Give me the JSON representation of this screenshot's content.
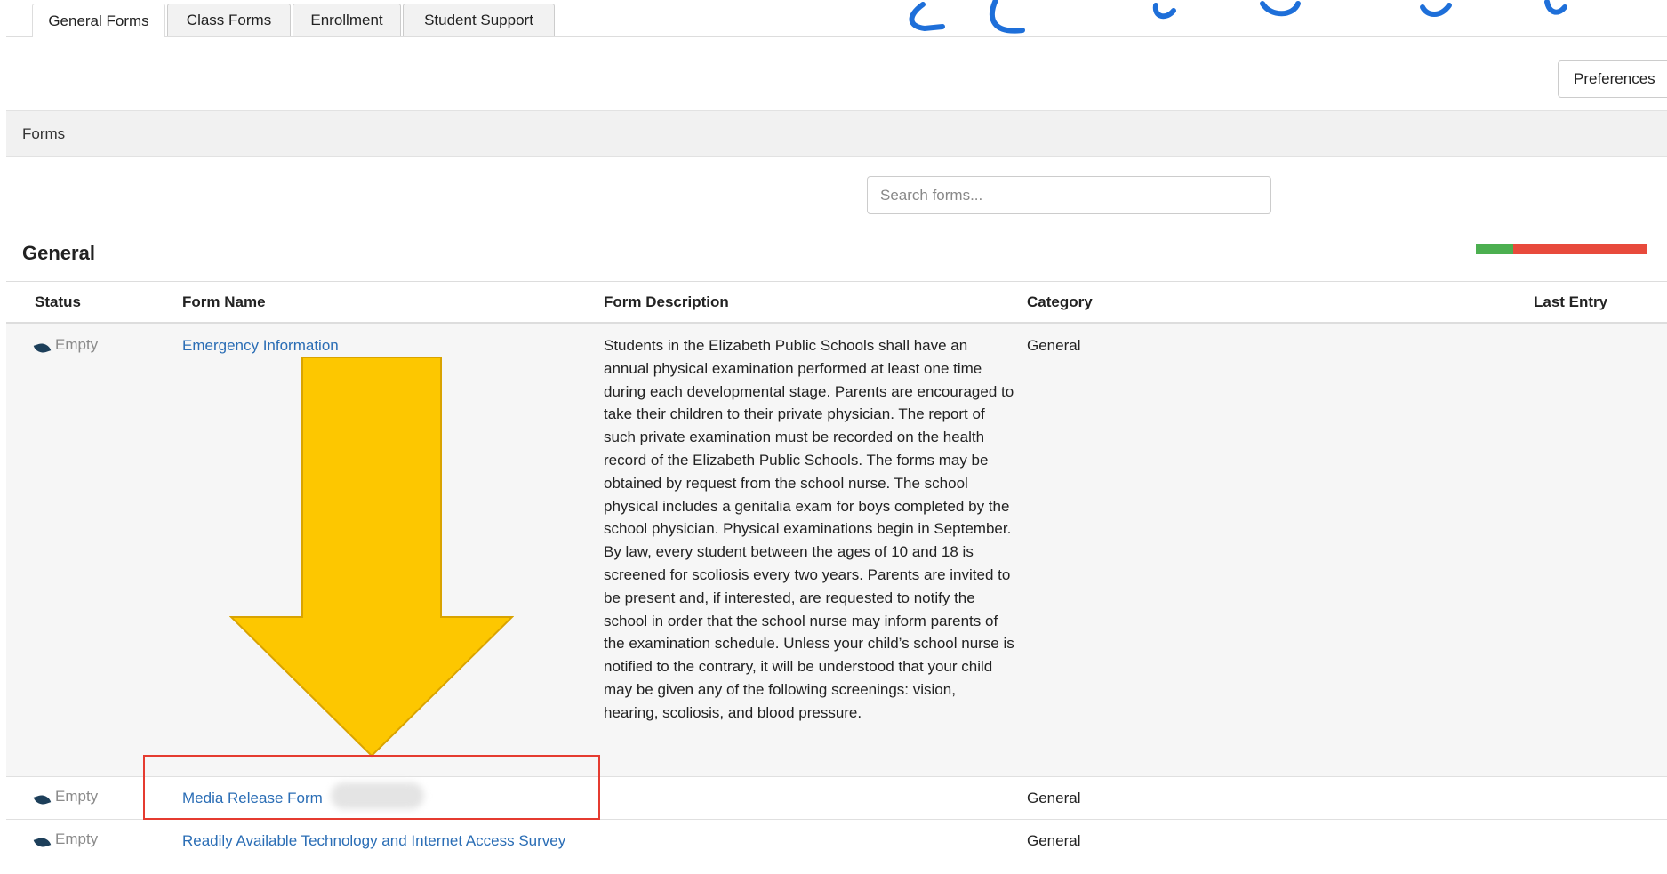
{
  "tabs": [
    {
      "label": "General Forms",
      "active": true
    },
    {
      "label": "Class Forms",
      "active": false
    },
    {
      "label": "Enrollment",
      "active": false
    },
    {
      "label": "Student Support",
      "active": false
    }
  ],
  "toolbar": {
    "preferences_label": "Preferences"
  },
  "forms_bar": {
    "title": "Forms"
  },
  "search": {
    "placeholder": "Search forms...",
    "value": ""
  },
  "section": {
    "title": "General",
    "progress": {
      "completed_fraction": 0.22,
      "colors": {
        "done": "#4caf50",
        "remaining": "#e84a3c"
      }
    }
  },
  "table": {
    "headers": {
      "status": "Status",
      "form_name": "Form Name",
      "description": "Form Description",
      "category": "Category",
      "last_entry": "Last Entry"
    },
    "rows": [
      {
        "status": "Empty",
        "status_icon": "leaf-icon",
        "name": "Emergency Information",
        "description": "Students in the Elizabeth Public Schools shall have an annual physical examination performed at least one time during each developmental stage. Parents are encouraged to take their children to their private physician. The report of such private examination must be recorded on the health record of the Elizabeth Public Schools. The forms may be obtained by request from the school nurse. The school physical includes a genitalia exam for boys completed by the school physician. Physical examinations begin in September. By law, every student between the ages of 10 and 18 is screened for scoliosis every two years. Parents are invited to be present and, if interested, are requested to notify the school in order that the school nurse may inform parents of the examination schedule. Unless your child’s school nurse is notified to the contrary, it will be understood that your child may be given any of the following screenings: vision, hearing, scoliosis, and blood pressure.",
        "category": "General",
        "last_entry": ""
      },
      {
        "status": "Empty",
        "status_icon": "leaf-icon",
        "name": "Media Release Form",
        "description": "",
        "category": "General",
        "last_entry": ""
      },
      {
        "status": "Empty",
        "status_icon": "leaf-icon",
        "name": "Readily Available Technology and Internet Access Survey",
        "description": "",
        "category": "General",
        "last_entry": ""
      }
    ]
  },
  "annotations": {
    "arrow_color": "#fdc700",
    "highlight_color": "#e53b30",
    "scribble_color": "#1e6fd9"
  }
}
